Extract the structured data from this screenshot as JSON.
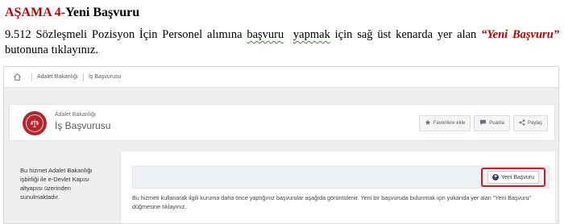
{
  "doc": {
    "heading_step": "AŞAMA 4-",
    "heading_title": "Yeni Başvuru",
    "para_1": "9.512 Sözleşmeli Pozisyon İçin Personel alımına ",
    "para_squiggle_1": "başvuru",
    "para_2": "  ",
    "para_squiggle_2": "yapmak",
    "para_3": " için sağ üst kenarda yer alan ",
    "para_quote": "“Yeni Başvuru”",
    "para_4": " butonuna tıklayınız."
  },
  "breadcrumb": {
    "items": [
      "Adalet Bakanlığı",
      "İş Başvurusu"
    ]
  },
  "header": {
    "org": "Adalet Bakanlığı",
    "service": "İş Başvurusu",
    "actions": [
      {
        "label": "Favorilere ekle",
        "icon": "star-icon"
      },
      {
        "label": "Puanla",
        "icon": "speech-bubble-icon"
      },
      {
        "label": "Paylaş",
        "icon": "share-icon"
      }
    ]
  },
  "sidebar": {
    "note": "Bu hizmet Adalet Bakanlığı işbirliği ile e-Devlet Kapısı altyapısı üzerinden sunulmaktadır."
  },
  "content": {
    "new_application_label": "Yeni Başvuru",
    "info": "Bu hizmeti kullanarak ilgili kuruma daha önce yaptığınız başvurular aşağıda görüntülenir. Yeni bir başvuruda bulunmak için yukarıda yer alan \"Yeni Başvuru\" düğmesine tıklayınız."
  },
  "colors": {
    "accent_red": "#c00000",
    "highlight_red": "#e0141b",
    "logo_red": "#b3262b"
  }
}
